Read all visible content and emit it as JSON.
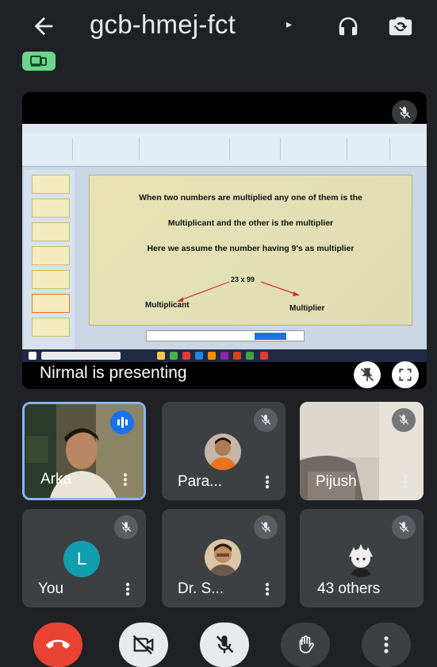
{
  "header": {
    "back_icon": "arrow-left-icon",
    "meeting_code": "gcb-hmej-fct",
    "caret": "▸",
    "audio_icon": "headphones-icon",
    "switch_camera_icon": "switch-camera-icon",
    "device_icon": "cast-device-icon",
    "device_chip_color": "#6dd58c"
  },
  "presentation": {
    "presenter_label": "Nirmal is presenting",
    "mute_icon": "mic-off-icon",
    "pin_icon": "unpin-icon",
    "fullscreen_icon": "fullscreen-icon",
    "slide": {
      "line1": "When two numbers are multiplied any one of them  is the",
      "line2": "Multiplicant and the other is the multiplier",
      "line3": "Here we assume the number having 9's as multiplier",
      "equation": "23 x 99",
      "label_left": "Multiplicant",
      "label_right": "Multiplier"
    }
  },
  "participants": [
    {
      "name": "Arka",
      "speaking": true,
      "muted": false,
      "video": true
    },
    {
      "name": "Para...",
      "speaking": false,
      "muted": true,
      "video": false
    },
    {
      "name": "Pijush",
      "speaking": false,
      "muted": true,
      "video": true
    },
    {
      "name": "You",
      "speaking": false,
      "muted": true,
      "video": false,
      "avatar_letter": "L",
      "avatar_color": "#129eaf"
    },
    {
      "name": "Dr. S...",
      "speaking": false,
      "muted": true,
      "video": false
    },
    {
      "name": "43 others",
      "speaking": false,
      "muted": true,
      "video": false
    }
  ],
  "controls": {
    "end_call_icon": "end-call-icon",
    "camera_icon": "camera-off-icon",
    "mic_icon": "mic-off-icon",
    "hand_icon": "raise-hand-icon",
    "more_icon": "more-vert-icon",
    "end_color": "#ea4335"
  },
  "colors": {
    "background": "#202124",
    "tile": "#3c4043",
    "active_border": "#8ab4f8",
    "accent": "#1a73e8"
  }
}
